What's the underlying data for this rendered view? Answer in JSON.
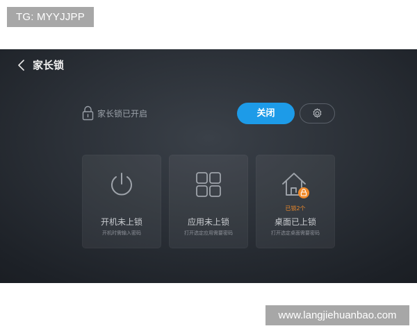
{
  "watermarks": {
    "top": "TG: MYYJJPP",
    "bottom": "www.langjiehuanbao.com"
  },
  "header": {
    "title": "家长锁",
    "back_icon": "chevron-left-icon"
  },
  "status": {
    "icon": "lock-icon",
    "text": "家长锁已开启"
  },
  "actions": {
    "close_label": "关闭",
    "settings_icon": "gear-icon",
    "accent_color": "#1d9be8"
  },
  "cards": [
    {
      "icon": "power-icon",
      "badge": "",
      "title": "开机未上锁",
      "desc": "开机时需输入密码"
    },
    {
      "icon": "apps-grid-icon",
      "badge": "",
      "title": "应用未上锁",
      "desc": "打开选定应用需要密码"
    },
    {
      "icon": "home-lock-icon",
      "badge": "已锁2个",
      "title": "桌面已上锁",
      "desc": "打开选定桌面需要密码",
      "badge_color": "#f08a2a"
    }
  ]
}
